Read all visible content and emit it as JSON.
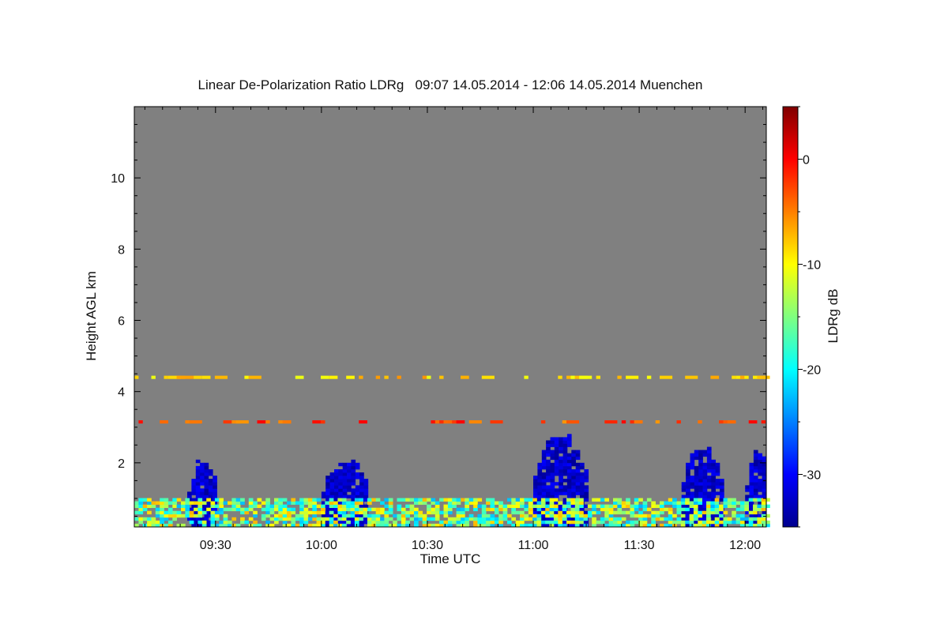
{
  "chart_data": {
    "type": "heatmap",
    "title": "Linear De-Polarization Ratio LDRg   09:07 14.05.2014 - 12:06 14.05.2014 Muenchen",
    "xlabel": "Time UTC",
    "ylabel": "Height AGL km",
    "colorbar_label": "LDRg dB",
    "x_range": [
      "09:07",
      "12:06"
    ],
    "x_ticks": [
      "09:30",
      "10:00",
      "10:30",
      "11:00",
      "11:30",
      "12:00"
    ],
    "ylim": [
      0.2,
      12.0
    ],
    "y_ticks": [
      2,
      4,
      6,
      8,
      10
    ],
    "color_range": [
      -35,
      5
    ],
    "colorbar_ticks": [
      0,
      -10,
      -20,
      -30
    ],
    "colormap": "jet",
    "background_color": "#808080",
    "features": [
      {
        "description": "blue plume",
        "time_start": "11:00",
        "time_end": "11:15",
        "height_top_km": 2.9,
        "ldr_db": -32
      },
      {
        "description": "blue plume",
        "time_start": "11:42",
        "time_end": "11:53",
        "height_top_km": 2.7,
        "ldr_db": -32
      },
      {
        "description": "blue plume",
        "time_start": "10:00",
        "time_end": "10:13",
        "height_top_km": 2.2,
        "ldr_db": -32
      },
      {
        "description": "blue plume",
        "time_start": "12:00",
        "time_end": "12:06",
        "height_top_km": 2.5,
        "ldr_db": -32
      },
      {
        "description": "blue plume",
        "time_start": "09:22",
        "time_end": "09:30",
        "height_top_km": 2.2,
        "ldr_db": -32
      },
      {
        "description": "layer",
        "time_start": "09:07",
        "time_end": "12:06",
        "height_km": 4.4,
        "ldr_db": -8
      },
      {
        "description": "layer",
        "time_start": "09:07",
        "time_end": "12:06",
        "height_km": 3.15,
        "ldr_db": -3
      },
      {
        "description": "boundary layer",
        "time_start": "09:07",
        "time_end": "12:06",
        "height_top_km": 1.0,
        "ldr_db": -15
      }
    ]
  }
}
